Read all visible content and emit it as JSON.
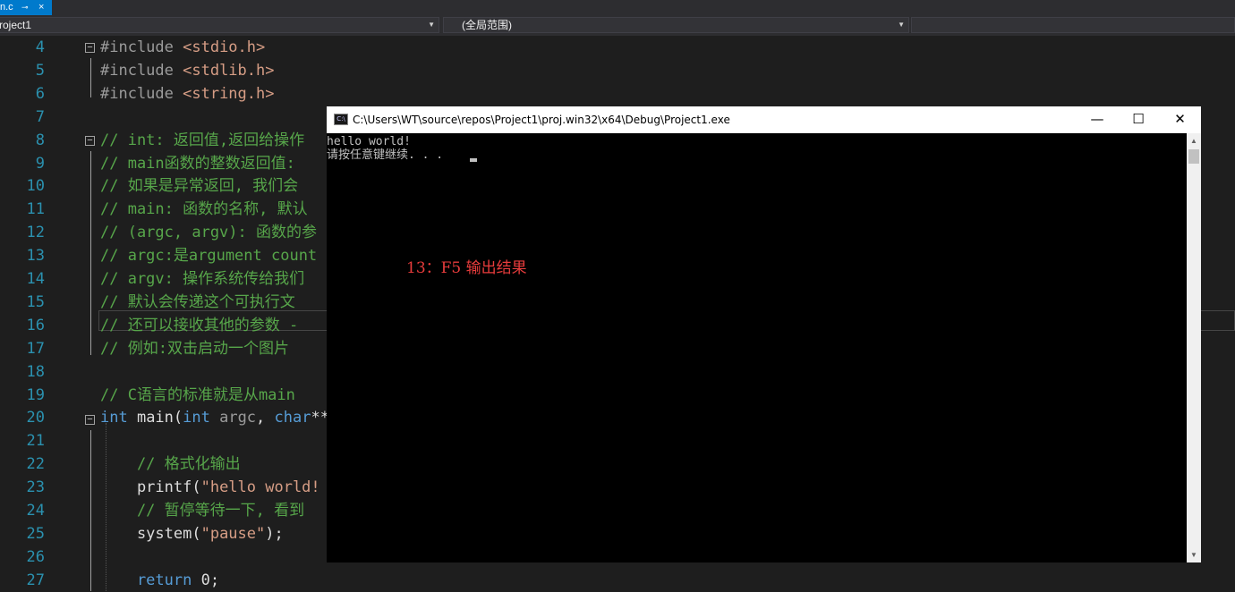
{
  "tab": {
    "name": "n.c",
    "pin": "⊸",
    "close": "×"
  },
  "navbar": {
    "project": "roject1",
    "scope": "(全局范围)"
  },
  "editor": {
    "line_numbers": [
      "4",
      "5",
      "6",
      "7",
      "8",
      "9",
      "10",
      "11",
      "12",
      "13",
      "14",
      "15",
      "16",
      "17",
      "18",
      "19",
      "20",
      "21",
      "22",
      "23",
      "24",
      "25",
      "26",
      "27"
    ],
    "lines": [
      [
        {
          "c": "pp",
          "t": "#include "
        },
        {
          "c": "str",
          "t": "<stdio.h>"
        }
      ],
      [
        {
          "c": "pp",
          "t": "#include "
        },
        {
          "c": "str",
          "t": "<stdlib.h>"
        }
      ],
      [
        {
          "c": "pp",
          "t": "#include "
        },
        {
          "c": "str",
          "t": "<string.h>"
        }
      ],
      [],
      [
        {
          "c": "cmt",
          "t": "// int: 返回值,返回给操作"
        }
      ],
      [
        {
          "c": "cmt",
          "t": "// main函数的整数返回值:"
        }
      ],
      [
        {
          "c": "cmt",
          "t": "// 如果是异常返回, 我们会"
        }
      ],
      [
        {
          "c": "cmt",
          "t": "// main: 函数的名称, 默认"
        }
      ],
      [
        {
          "c": "cmt",
          "t": "// (argc, argv): 函数的参"
        }
      ],
      [
        {
          "c": "cmt",
          "t": "// argc:是argument count"
        }
      ],
      [
        {
          "c": "cmt",
          "t": "// argv: 操作系统传给我们"
        }
      ],
      [
        {
          "c": "cmt",
          "t": "// 默认会传递这个可执行文"
        }
      ],
      [
        {
          "c": "cmt",
          "t": "// 还可以接收其他的参数 -"
        }
      ],
      [
        {
          "c": "cmt",
          "t": "// 例如:双击启动一个图片"
        }
      ],
      [],
      [
        {
          "c": "cmt",
          "t": "// C语言的标准就是从main"
        }
      ],
      [
        {
          "c": "kw",
          "t": "int"
        },
        {
          "c": "ident",
          "t": " main("
        },
        {
          "c": "kw",
          "t": "int"
        },
        {
          "c": "param",
          "t": " argc"
        },
        {
          "c": "ident",
          "t": ", "
        },
        {
          "c": "kw",
          "t": "char"
        },
        {
          "c": "ident",
          "t": "**"
        }
      ],
      [],
      [
        {
          "c": "cmt",
          "t": "    // 格式化输出"
        }
      ],
      [
        {
          "c": "ident",
          "t": "    printf("
        },
        {
          "c": "str",
          "t": "\"hello world!"
        }
      ],
      [
        {
          "c": "cmt",
          "t": "    // 暂停等待一下, 看到"
        }
      ],
      [
        {
          "c": "ident",
          "t": "    system("
        },
        {
          "c": "str",
          "t": "\"pause\""
        },
        {
          "c": "ident",
          "t": ");"
        }
      ],
      [],
      [
        {
          "c": "kw",
          "t": "    return"
        },
        {
          "c": "ident",
          "t": " 0;"
        }
      ]
    ]
  },
  "console": {
    "title": "C:\\Users\\WT\\source\\repos\\Project1\\proj.win32\\x64\\Debug\\Project1.exe",
    "icon_label": "C:\\",
    "output": [
      "hello world!",
      "请按任意键继续. . ."
    ],
    "annotation": "13：F5  输出结果",
    "buttons": {
      "minimize": "—",
      "maximize": "☐",
      "close": "✕"
    },
    "scroll": {
      "up": "▲",
      "down": "▼"
    }
  },
  "icons": {
    "fold": "minus-box-icon",
    "console": "console-app-icon"
  }
}
